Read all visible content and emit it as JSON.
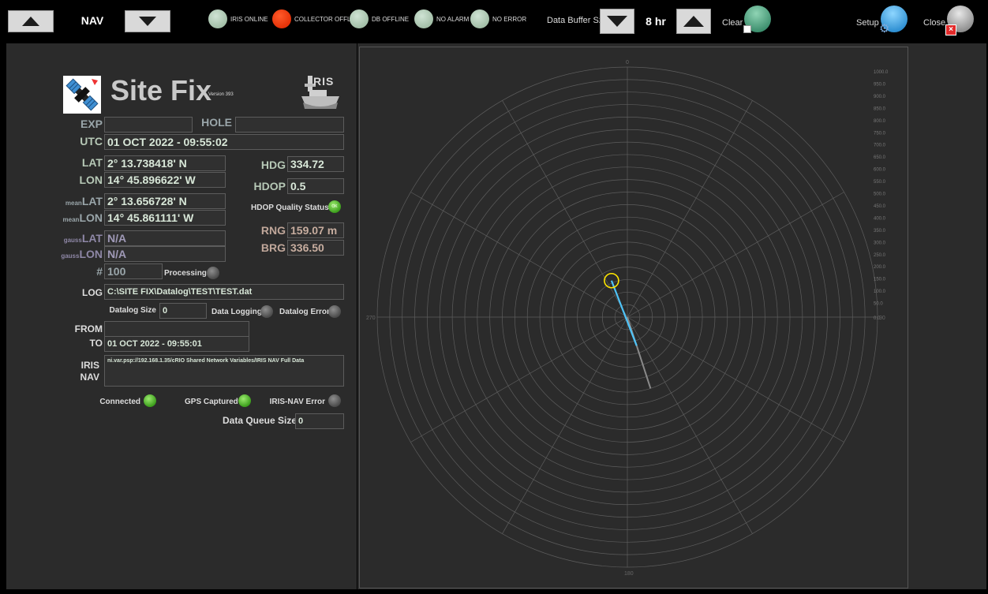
{
  "window": {
    "nav_label": "NAV",
    "buffer_label": "Data Buffer Sz",
    "buffer_value": "8 hr",
    "clear_label": "Clear",
    "setup_label": "Setup",
    "close_label": "Close"
  },
  "status_indicators": [
    {
      "label": "IRIS ONLINE",
      "state": "online"
    },
    {
      "label": "COLLECTOR OFFLINE",
      "state": "offline"
    },
    {
      "label": "DB OFFLINE",
      "state": "online"
    },
    {
      "label": "NO ALARM",
      "state": "online"
    },
    {
      "label": "NO ERROR",
      "state": "online"
    }
  ],
  "header": {
    "title": "Site Fix",
    "version": "Version 393",
    "logo_text": "RIS"
  },
  "fields": {
    "exp_label": "EXP",
    "exp_value": "",
    "hole_label": "HOLE",
    "hole_value": "",
    "utc_label": "UTC",
    "utc_value": "01 OCT 2022 - 09:55:02",
    "lat_label": "LAT",
    "lat_value": "2° 13.738418' N",
    "lon_label": "LON",
    "lon_value": "14° 45.896622' W",
    "hdg_label": "HDG",
    "hdg_value": "334.72",
    "hdop_label": "HDOP",
    "hdop_value": "0.5",
    "hdop_quality_label": "HDOP Quality Status",
    "hdop_quality_led_text": "OK",
    "mean_prefix": "mean",
    "meanlat_label": "LAT",
    "meanlat_value": "2° 13.656728' N",
    "meanlon_label": "LON",
    "meanlon_value": "14° 45.861111' W",
    "gauss_prefix": "gauss",
    "gausslat_label": "LAT",
    "gausslat_value": "N/A",
    "gausslon_label": "LON",
    "gausslon_value": "N/A",
    "rng_label": "RNG",
    "rng_value": "159.07 m",
    "brg_label": "BRG",
    "brg_value": "336.50",
    "count_label": "#",
    "count_value": "100",
    "processing_label": "Processing",
    "log_label": "LOG",
    "log_value": "C:\\SITE FIX\\Datalog\\TEST\\TEST.dat",
    "datalog_size_label": "Datalog Size",
    "datalog_size_value": "0",
    "data_logging_label": "Data Logging",
    "datalog_error_label": "Datalog Error",
    "from_label": "FROM",
    "from_value": "",
    "to_label": "TO",
    "to_value": "01 OCT 2022 - 09:55:01",
    "iris_label": "IRIS",
    "nav_label": "NAV",
    "iris_nav_value": "ni.var.psp://192.168.1.35/cRIO Shared Network Variables/IRIS NAV Full Data",
    "connected_label": "Connected",
    "gps_captured_label": "GPS Captured",
    "iris_nav_error_label": "IRIS-NAV Error",
    "queue_size_label": "Data Queue Size",
    "queue_size_value": "0"
  },
  "colors": {
    "background": "#2b2b2b",
    "led_green": "#3c9e1c",
    "led_red": "#e53208",
    "track": "#4fc3f7",
    "marker": "#ffe600"
  },
  "polar_chart": {
    "angle_labels": [
      "0",
      "90",
      "180",
      "270"
    ],
    "range_labels": [
      "1000.0",
      "950.0",
      "900.0",
      "850.0",
      "800.0",
      "750.0",
      "700.0",
      "650.0",
      "600.0",
      "550.0",
      "500.0",
      "450.0",
      "400.0",
      "350.0",
      "300.0",
      "250.0",
      "200.0",
      "150.0",
      "100.0",
      "50.0",
      "0.0"
    ],
    "range_max": 1000,
    "ring_step": 50,
    "spoke_step_deg": 30,
    "current_fix": {
      "range_m": 159.07,
      "bearing_deg": 336.5
    },
    "trail_end": {
      "range_m": 300,
      "bearing_deg": 162
    }
  }
}
